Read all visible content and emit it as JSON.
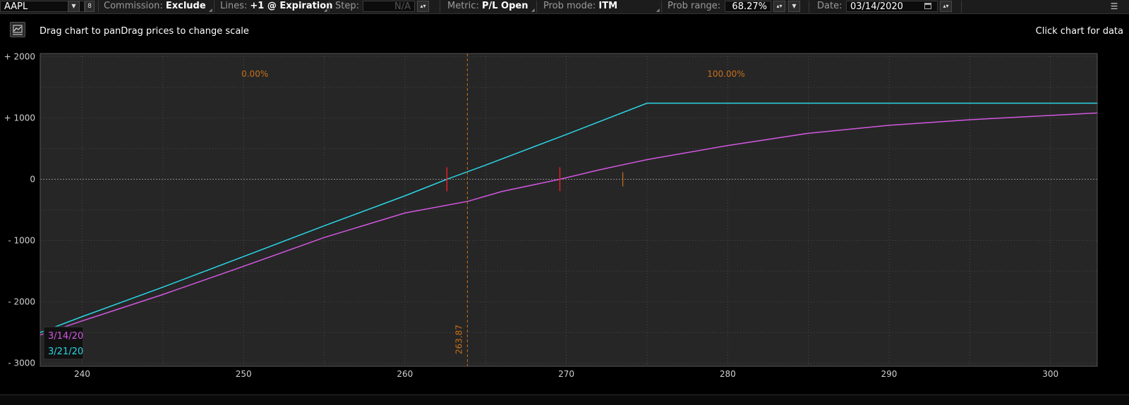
{
  "toolbar": {
    "symbol": "AAPL",
    "commission_label": "Commission:",
    "commission_value": "Exclude",
    "lines_label": "Lines:",
    "lines_value": "+1 @ Expiration",
    "step_label": "Step:",
    "step_value": "N/A",
    "metric_label": "Metric:",
    "metric_value": "P/L Open",
    "prob_mode_label": "Prob mode:",
    "prob_mode_value": "ITM",
    "prob_range_label": "Prob range:",
    "prob_range_value": "68.27%",
    "date_label": "Date:",
    "date_value": "03/14/2020"
  },
  "info": {
    "hint": "Drag chart to panDrag prices to change scale",
    "click_hint": "Click chart for data"
  },
  "colors": {
    "background": "#000000",
    "plot_background": "#262626",
    "series_3_14": "#d257e0",
    "series_3_21": "#2ad6e6",
    "marker": "#e0202a",
    "price_line": "#c8701a"
  },
  "icons": {
    "chart_icon": "chart-area-icon",
    "menu_icon": "list-menu-icon",
    "calendar_icon": "calendar-icon"
  },
  "chart_data": {
    "type": "line",
    "title": "",
    "xlabel": "",
    "ylabel": "",
    "xlim": [
      237.4,
      302.9
    ],
    "ylim": [
      -3050,
      2050
    ],
    "x_ticks": [
      240,
      250,
      260,
      270,
      280,
      290,
      300
    ],
    "x_tick_labels": [
      "240",
      "250",
      "260",
      "270",
      "280",
      "290",
      "300"
    ],
    "y_ticks": [
      2000,
      1000,
      0,
      -1000,
      -2000,
      -3000
    ],
    "y_tick_labels": [
      "+ 2000",
      "+ 1000",
      "0",
      "- 1000",
      "- 2000",
      "- 3000"
    ],
    "grid": true,
    "legend_position": "bottom-left",
    "probability_labels": [
      "0.00%",
      "100.00%"
    ],
    "current_price": 263.87,
    "current_price_label": "263.87",
    "series": [
      {
        "name": "3/14/20",
        "x": [
          237.4,
          240,
          245,
          250,
          255,
          260,
          263.9,
          266,
          269.6,
          272,
          275,
          280,
          285,
          290,
          295,
          300,
          302.9
        ],
        "y": [
          -2540,
          -2310,
          -1880,
          -1420,
          -950,
          -550,
          -360,
          -200,
          0,
          150,
          320,
          550,
          750,
          880,
          970,
          1040,
          1080
        ]
      },
      {
        "name": "3/21/20",
        "x": [
          237.4,
          240,
          245,
          250,
          255,
          260,
          262.6,
          265,
          270,
          275,
          280,
          285,
          290,
          295,
          300,
          302.9
        ],
        "y": [
          -2500,
          -2240,
          -1760,
          -1260,
          -760,
          -270,
          0,
          230,
          730,
          1240,
          1240,
          1240,
          1240,
          1240,
          1240,
          1240
        ]
      }
    ],
    "breakeven_markers": [
      262.6,
      269.6
    ],
    "small_marker": 273.5
  }
}
